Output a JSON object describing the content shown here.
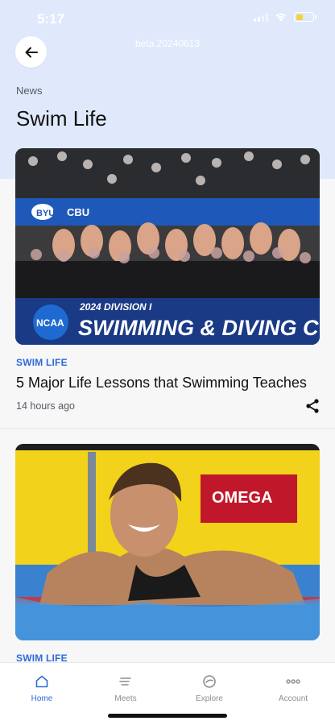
{
  "status_bar": {
    "time": "5:17",
    "battery_level": 0.4
  },
  "build": "beta.20240613",
  "header": {
    "section": "News",
    "title": "Swim Life"
  },
  "articles": [
    {
      "category": "SWIM LIFE",
      "title": "5 Major Life Lessons that Swimming Teaches",
      "time": "14 hours ago",
      "banner_text": "2024 DIVISION I",
      "banner_text_2": "SWIMMING & DIVING C",
      "banner_logo": "NCAA",
      "banner_top": "BYU",
      "banner_top_2": "CBU"
    },
    {
      "category": "SWIM LIFE",
      "sign_text": "OMEGA"
    }
  ],
  "nav": {
    "items": [
      {
        "label": "Home",
        "icon": "home-icon"
      },
      {
        "label": "Meets",
        "icon": "meets-icon"
      },
      {
        "label": "Explore",
        "icon": "explore-icon"
      },
      {
        "label": "Account",
        "icon": "more-icon"
      }
    ]
  },
  "colors": {
    "accent": "#2f6ad9",
    "hero_bg": "#dfe9fb",
    "banner": "#1a3a86"
  }
}
